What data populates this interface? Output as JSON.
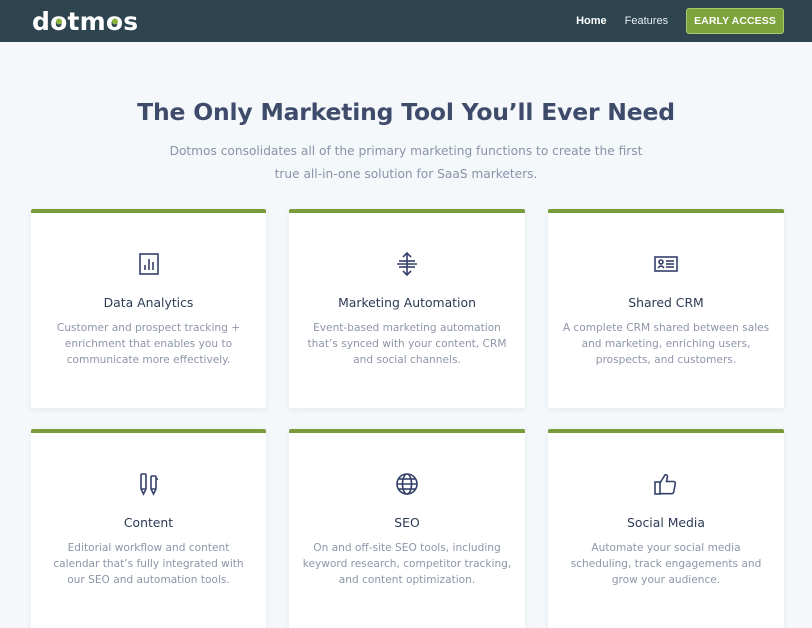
{
  "header": {
    "logo_text": "dotmos",
    "nav": [
      {
        "label": "Home",
        "active": true
      },
      {
        "label": "Features",
        "active": false
      }
    ],
    "cta_label": "EARLY ACCESS"
  },
  "hero": {
    "title": "The Only Marketing Tool You’ll Ever Need",
    "subtitle": "Dotmos consolidates all of the primary marketing functions to create the first true all-in-one solution for SaaS marketers."
  },
  "features": [
    {
      "icon": "bar-chart-icon",
      "title": "Data Analytics",
      "description": "Customer and prospect tracking + enrichment that enables you to communicate more effectively."
    },
    {
      "icon": "arrows-vertical-icon",
      "title": "Marketing Automation",
      "description": "Event-based marketing automation that’s synced with your content, CRM and social channels."
    },
    {
      "icon": "id-card-icon",
      "title": "Shared CRM",
      "description": "A complete CRM shared between sales and marketing, enriching users, prospects, and customers."
    },
    {
      "icon": "pen-pencil-icon",
      "title": "Content",
      "description": "Editorial workflow and content calendar that’s fully integrated with our SEO and automation tools."
    },
    {
      "icon": "globe-icon",
      "title": "SEO",
      "description": "On and off-site SEO tools, including keyword research, competitor tracking, and content optimization."
    },
    {
      "icon": "thumbs-up-icon",
      "title": "Social Media",
      "description": "Automate your social media scheduling, track engagements and grow your audience."
    }
  ],
  "colors": {
    "header_bg": "#2e4550",
    "accent": "#7a9b39",
    "title": "#3f4b6b",
    "muted": "#8d96a8"
  }
}
